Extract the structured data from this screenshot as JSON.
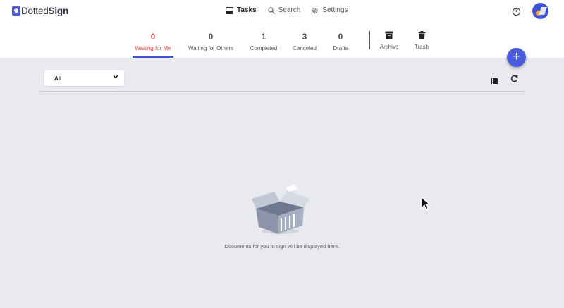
{
  "app": {
    "logo_text_a": "Dotted",
    "logo_text_b": "Sign"
  },
  "topnav": [
    {
      "label": "Tasks",
      "icon": "inbox-icon",
      "active": true
    },
    {
      "label": "Search",
      "icon": "search-icon",
      "active": false
    },
    {
      "label": "Settings",
      "icon": "gear-icon",
      "active": false
    }
  ],
  "header": {
    "help_label": "?"
  },
  "tabs": [
    {
      "count": "0",
      "label": "Waiting for Me",
      "active": true
    },
    {
      "count": "0",
      "label": "Waiting for Others"
    },
    {
      "count": "1",
      "label": "Completed"
    },
    {
      "count": "3",
      "label": "Canceled"
    },
    {
      "count": "0",
      "label": "Drafts"
    }
  ],
  "icon_tabs": [
    {
      "label": "Archive",
      "icon": "archive-icon"
    },
    {
      "label": "Trash",
      "icon": "trash-icon"
    }
  ],
  "fab": {
    "label": "+"
  },
  "filter": {
    "selected": "All"
  },
  "empty_state": {
    "message": "Documents for you to sign will be displayed here."
  },
  "colors": {
    "accent": "#4a5bdf",
    "active_tab": "#e0443c",
    "background": "#e8eaef"
  }
}
